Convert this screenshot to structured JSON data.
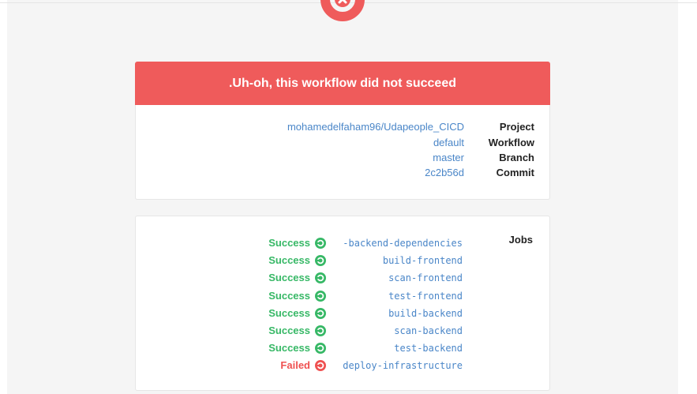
{
  "header": {
    "logo_icon": "circleci-fail-icon",
    "title": ".Uh-oh, this workflow did not succeed",
    "accent_color": "#ef5b5b"
  },
  "details": [
    {
      "label": "Project",
      "value": "mohamedelfaham96/Udapeople_CICD"
    },
    {
      "label": "Workflow",
      "value": "default"
    },
    {
      "label": "Branch",
      "value": "master"
    },
    {
      "label": "Commit",
      "value": "2c2b56d"
    }
  ],
  "jobs": {
    "title": "Jobs",
    "items": [
      {
        "status": "Success",
        "name": "-backend-dependencies",
        "state": "success"
      },
      {
        "status": "Success",
        "name": "build-frontend",
        "state": "success"
      },
      {
        "status": "Success",
        "name": "scan-frontend",
        "state": "success"
      },
      {
        "status": "Success",
        "name": "test-frontend",
        "state": "success"
      },
      {
        "status": "Success",
        "name": "build-backend",
        "state": "success"
      },
      {
        "status": "Success",
        "name": "scan-backend",
        "state": "success"
      },
      {
        "status": "Success",
        "name": "test-backend",
        "state": "success"
      },
      {
        "status": "Failed",
        "name": "deploy-infrastructure",
        "state": "failed"
      }
    ],
    "success_color": "#37b866",
    "failed_color": "#ef5151"
  }
}
